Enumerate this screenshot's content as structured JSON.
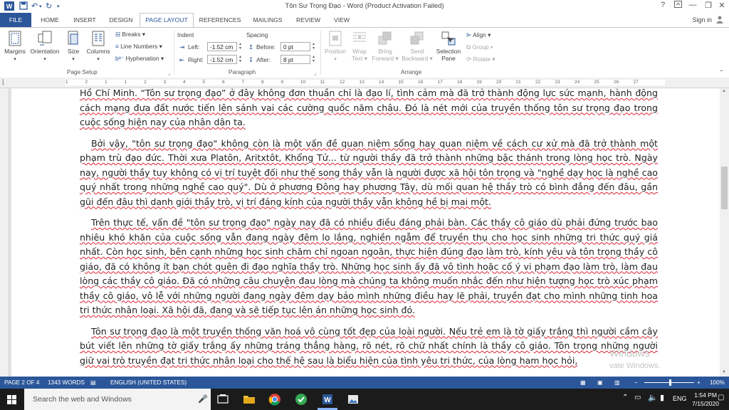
{
  "window": {
    "title": "Tôn Sư Trọng Đạo - Word (Product Activation Failed)"
  },
  "tabs": [
    {
      "label": "FILE"
    },
    {
      "label": "HOME"
    },
    {
      "label": "INSERT"
    },
    {
      "label": "DESIGN"
    },
    {
      "label": "PAGE LAYOUT"
    },
    {
      "label": "REFERENCES"
    },
    {
      "label": "MAILINGS"
    },
    {
      "label": "REVIEW"
    },
    {
      "label": "VIEW"
    }
  ],
  "signin": "Sign in",
  "ribbon": {
    "page_setup": {
      "label": "Page Setup",
      "margins": "Margins",
      "orientation": "Orientation",
      "size": "Size",
      "columns": "Columns",
      "breaks": "Breaks",
      "line_numbers": "Line Numbers",
      "hyphenation": "Hyphenation"
    },
    "paragraph": {
      "label": "Paragraph",
      "indent": "Indent",
      "spacing": "Spacing",
      "left_label": "Left:",
      "left_value": "-1.52 cm",
      "right_label": "Right:",
      "right_value": "-1.52 cm",
      "before_label": "Before:",
      "before_value": "0 pt",
      "after_label": "After:",
      "after_value": "8 pt"
    },
    "arrange": {
      "label": "Arrange",
      "position": "Position",
      "wrap_text_1": "Wrap",
      "wrap_text_2": "Text",
      "bring_forward_1": "Bring",
      "bring_forward_2": "Forward",
      "send_backward_1": "Send",
      "send_backward_2": "Backward",
      "selection_pane_1": "Selection",
      "selection_pane_2": "Pane",
      "align": "Align",
      "group": "Group",
      "rotate": "Rotate"
    }
  },
  "ruler": {
    "ticks": [
      "1",
      "2",
      "1",
      "1",
      "2",
      "3",
      "4",
      "5",
      "6",
      "7",
      "8",
      "9",
      "10",
      "11",
      "12",
      "13",
      "14",
      "15",
      "16",
      "17",
      "18",
      "19",
      "20",
      "21",
      "22",
      "23",
      "24",
      "25",
      "26",
      "27"
    ]
  },
  "document": {
    "paragraphs": [
      "Hồ Chí Minh. “Tôn sư trọng đạo” ở đây không đơn thuần chỉ là đạo lí, tình cảm mà đã trở thành động lực sức mạnh, hành động cách mạng đưa đất nước tiến lên sánh vai các cường quốc năm châu. Đó là nét mới của truyền thống tôn sư trọng đạo trong cuộc sống hiện nay của nhân dân ta.",
      "Bởi vậy, \"tôn sư trọng đạo\" không còn là một vấn đề quan niệm sống hay quan niệm về cách cư xử mà đã trở thành một phạm trù đạo đức. Thời xưa Platôn, Aritxtôt, Khổng Tử... từ người thầy đã trở thành những bậc thánh trong lòng học trò. Ngày nay, người thầy tuy không có vị trí tuyệt đối như thế song thầy vẫn là người được xã hội tôn trọng và \"nghề dạy học là nghề cao quý nhất trong những nghề cao quý\". Dù ở phương Đông hay phương Tây, dù mối quan hệ thầy trò có bình đẳng đến đâu, gần gũi đến đâu thì danh giới thầy trò, vị trí đáng kính của người thầy vẫn không hề bị mai một.",
      "Trên thực tế, vấn đề \"tôn sư trọng đạo\" ngày nay đã có nhiều điều đáng phải bàn. Các thầy cô giáo dù phải đứng trước bao nhiêu khó khăn của cuộc sống vẫn đang ngày đêm lo lắng, nghiền ngẫm để truyền thụ cho học sinh những tri thức quý giá nhất. Còn học sinh, bên cạnh những học sinh chăm chỉ ngoan ngoãn, thực hiện đúng đạo làm trò, kính yêu và tôn trọng thầy cô giáo, đã có không ít bạn chót quên đi đạo nghĩa thầy trò. Những học sinh ấy đã vô tình hoặc cố ý vi phạm đạo làm trò, làm đau lòng các thầy cô giáo. Đã có những câu chuyện đau lòng mà chúng ta không muốn nhắc đến như hiện tượng học trò xúc phạm thầy cô giáo, vô lễ với những người đang ngày đêm dạy bảo mình những điều hay lẽ phải, truyền đạt cho mình những tinh hoa tri thức nhân loại. Xã hội đã, đang và sẽ tiếp tục lên án những học sinh đó.",
      "Tôn sư trọng đạo là một truyền thống văn hoá vô cùng tốt đẹp của loài người. Nếu trẻ em là tờ giấy trắng thì người cầm cây bút viết lên những tờ giấy trắng ấy những tráng thẳng hàng, rõ nét, rõ chữ nhất chính là thầy cô giáo. Tôn trọng những người giữ vai trò truyền đạt tri thức nhân loại cho thế hệ sau là biểu hiện của tình yêu tri thức, của lòng ham học hỏi,"
    ],
    "watermark_1": "Windows",
    "watermark_2": "vate Windows."
  },
  "statusbar": {
    "page": "PAGE 2 OF 4",
    "words": "1343 WORDS",
    "language": "ENGLISH (UNITED STATES)",
    "zoom": "100%",
    "zoom_level": 1.0
  },
  "taskbar": {
    "search_placeholder": "Search the web and Windows",
    "lang": "ENG",
    "time": "1:54 PM",
    "date": "7/15/2020"
  },
  "colors": {
    "accent": "#2b579a",
    "spellcheck": "#dd2222"
  }
}
